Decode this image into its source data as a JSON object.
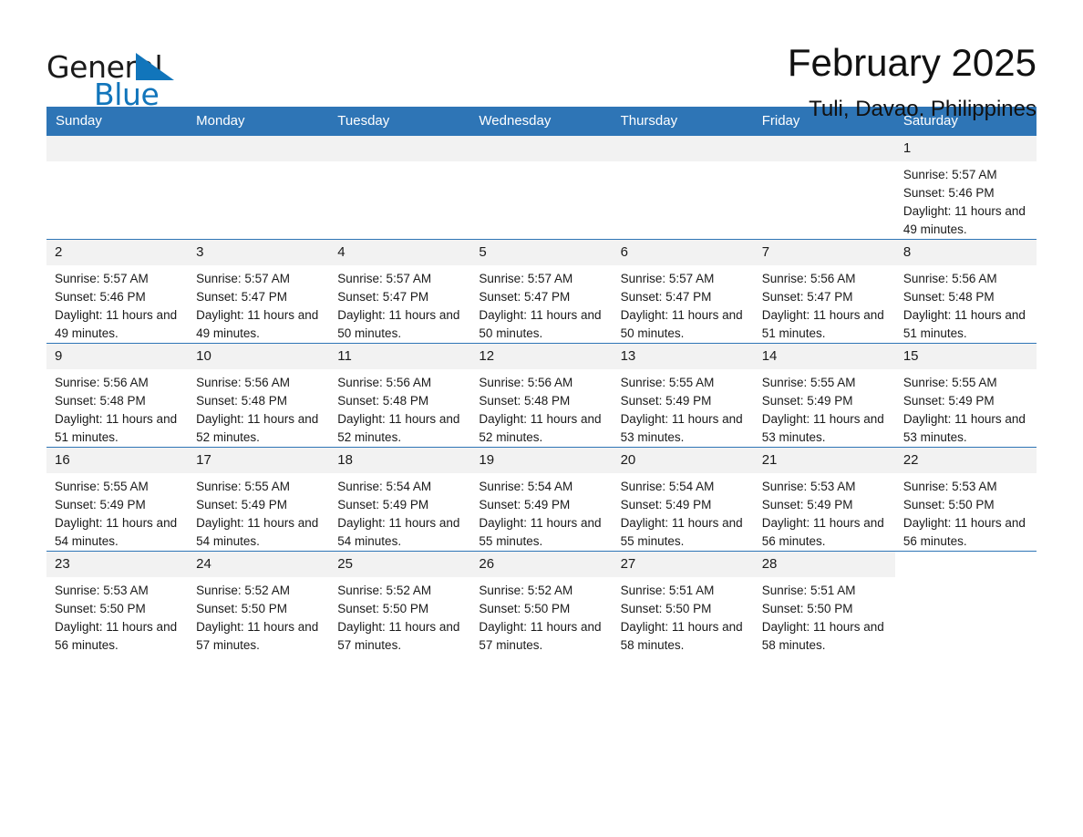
{
  "logo": {
    "part1": "General",
    "part2": "Blue",
    "triangle_color": "#1175bb"
  },
  "header": {
    "title": "February 2025",
    "subtitle": "Tuli, Davao, Philippines"
  },
  "theme": {
    "header_bg": "#2e75b6",
    "daynum_bg": "#f2f2f2",
    "text": "#1a1a1a"
  },
  "calendar": {
    "weekday_headers": [
      "Sunday",
      "Monday",
      "Tuesday",
      "Wednesday",
      "Thursday",
      "Friday",
      "Saturday"
    ],
    "weeks": [
      [
        {
          "day": "",
          "blank": true
        },
        {
          "day": "",
          "blank": true
        },
        {
          "day": "",
          "blank": true
        },
        {
          "day": "",
          "blank": true
        },
        {
          "day": "",
          "blank": true
        },
        {
          "day": "",
          "blank": true
        },
        {
          "day": "1",
          "sunrise": "Sunrise: 5:57 AM",
          "sunset": "Sunset: 5:46 PM",
          "daylight": "Daylight: 11 hours and 49 minutes."
        }
      ],
      [
        {
          "day": "2",
          "sunrise": "Sunrise: 5:57 AM",
          "sunset": "Sunset: 5:46 PM",
          "daylight": "Daylight: 11 hours and 49 minutes."
        },
        {
          "day": "3",
          "sunrise": "Sunrise: 5:57 AM",
          "sunset": "Sunset: 5:47 PM",
          "daylight": "Daylight: 11 hours and 49 minutes."
        },
        {
          "day": "4",
          "sunrise": "Sunrise: 5:57 AM",
          "sunset": "Sunset: 5:47 PM",
          "daylight": "Daylight: 11 hours and 50 minutes."
        },
        {
          "day": "5",
          "sunrise": "Sunrise: 5:57 AM",
          "sunset": "Sunset: 5:47 PM",
          "daylight": "Daylight: 11 hours and 50 minutes."
        },
        {
          "day": "6",
          "sunrise": "Sunrise: 5:57 AM",
          "sunset": "Sunset: 5:47 PM",
          "daylight": "Daylight: 11 hours and 50 minutes."
        },
        {
          "day": "7",
          "sunrise": "Sunrise: 5:56 AM",
          "sunset": "Sunset: 5:47 PM",
          "daylight": "Daylight: 11 hours and 51 minutes."
        },
        {
          "day": "8",
          "sunrise": "Sunrise: 5:56 AM",
          "sunset": "Sunset: 5:48 PM",
          "daylight": "Daylight: 11 hours and 51 minutes."
        }
      ],
      [
        {
          "day": "9",
          "sunrise": "Sunrise: 5:56 AM",
          "sunset": "Sunset: 5:48 PM",
          "daylight": "Daylight: 11 hours and 51 minutes."
        },
        {
          "day": "10",
          "sunrise": "Sunrise: 5:56 AM",
          "sunset": "Sunset: 5:48 PM",
          "daylight": "Daylight: 11 hours and 52 minutes."
        },
        {
          "day": "11",
          "sunrise": "Sunrise: 5:56 AM",
          "sunset": "Sunset: 5:48 PM",
          "daylight": "Daylight: 11 hours and 52 minutes."
        },
        {
          "day": "12",
          "sunrise": "Sunrise: 5:56 AM",
          "sunset": "Sunset: 5:48 PM",
          "daylight": "Daylight: 11 hours and 52 minutes."
        },
        {
          "day": "13",
          "sunrise": "Sunrise: 5:55 AM",
          "sunset": "Sunset: 5:49 PM",
          "daylight": "Daylight: 11 hours and 53 minutes."
        },
        {
          "day": "14",
          "sunrise": "Sunrise: 5:55 AM",
          "sunset": "Sunset: 5:49 PM",
          "daylight": "Daylight: 11 hours and 53 minutes."
        },
        {
          "day": "15",
          "sunrise": "Sunrise: 5:55 AM",
          "sunset": "Sunset: 5:49 PM",
          "daylight": "Daylight: 11 hours and 53 minutes."
        }
      ],
      [
        {
          "day": "16",
          "sunrise": "Sunrise: 5:55 AM",
          "sunset": "Sunset: 5:49 PM",
          "daylight": "Daylight: 11 hours and 54 minutes."
        },
        {
          "day": "17",
          "sunrise": "Sunrise: 5:55 AM",
          "sunset": "Sunset: 5:49 PM",
          "daylight": "Daylight: 11 hours and 54 minutes."
        },
        {
          "day": "18",
          "sunrise": "Sunrise: 5:54 AM",
          "sunset": "Sunset: 5:49 PM",
          "daylight": "Daylight: 11 hours and 54 minutes."
        },
        {
          "day": "19",
          "sunrise": "Sunrise: 5:54 AM",
          "sunset": "Sunset: 5:49 PM",
          "daylight": "Daylight: 11 hours and 55 minutes."
        },
        {
          "day": "20",
          "sunrise": "Sunrise: 5:54 AM",
          "sunset": "Sunset: 5:49 PM",
          "daylight": "Daylight: 11 hours and 55 minutes."
        },
        {
          "day": "21",
          "sunrise": "Sunrise: 5:53 AM",
          "sunset": "Sunset: 5:49 PM",
          "daylight": "Daylight: 11 hours and 56 minutes."
        },
        {
          "day": "22",
          "sunrise": "Sunrise: 5:53 AM",
          "sunset": "Sunset: 5:50 PM",
          "daylight": "Daylight: 11 hours and 56 minutes."
        }
      ],
      [
        {
          "day": "23",
          "sunrise": "Sunrise: 5:53 AM",
          "sunset": "Sunset: 5:50 PM",
          "daylight": "Daylight: 11 hours and 56 minutes."
        },
        {
          "day": "24",
          "sunrise": "Sunrise: 5:52 AM",
          "sunset": "Sunset: 5:50 PM",
          "daylight": "Daylight: 11 hours and 57 minutes."
        },
        {
          "day": "25",
          "sunrise": "Sunrise: 5:52 AM",
          "sunset": "Sunset: 5:50 PM",
          "daylight": "Daylight: 11 hours and 57 minutes."
        },
        {
          "day": "26",
          "sunrise": "Sunrise: 5:52 AM",
          "sunset": "Sunset: 5:50 PM",
          "daylight": "Daylight: 11 hours and 57 minutes."
        },
        {
          "day": "27",
          "sunrise": "Sunrise: 5:51 AM",
          "sunset": "Sunset: 5:50 PM",
          "daylight": "Daylight: 11 hours and 58 minutes."
        },
        {
          "day": "28",
          "sunrise": "Sunrise: 5:51 AM",
          "sunset": "Sunset: 5:50 PM",
          "daylight": "Daylight: 11 hours and 58 minutes."
        },
        {
          "day": "",
          "blank": true
        }
      ]
    ]
  }
}
